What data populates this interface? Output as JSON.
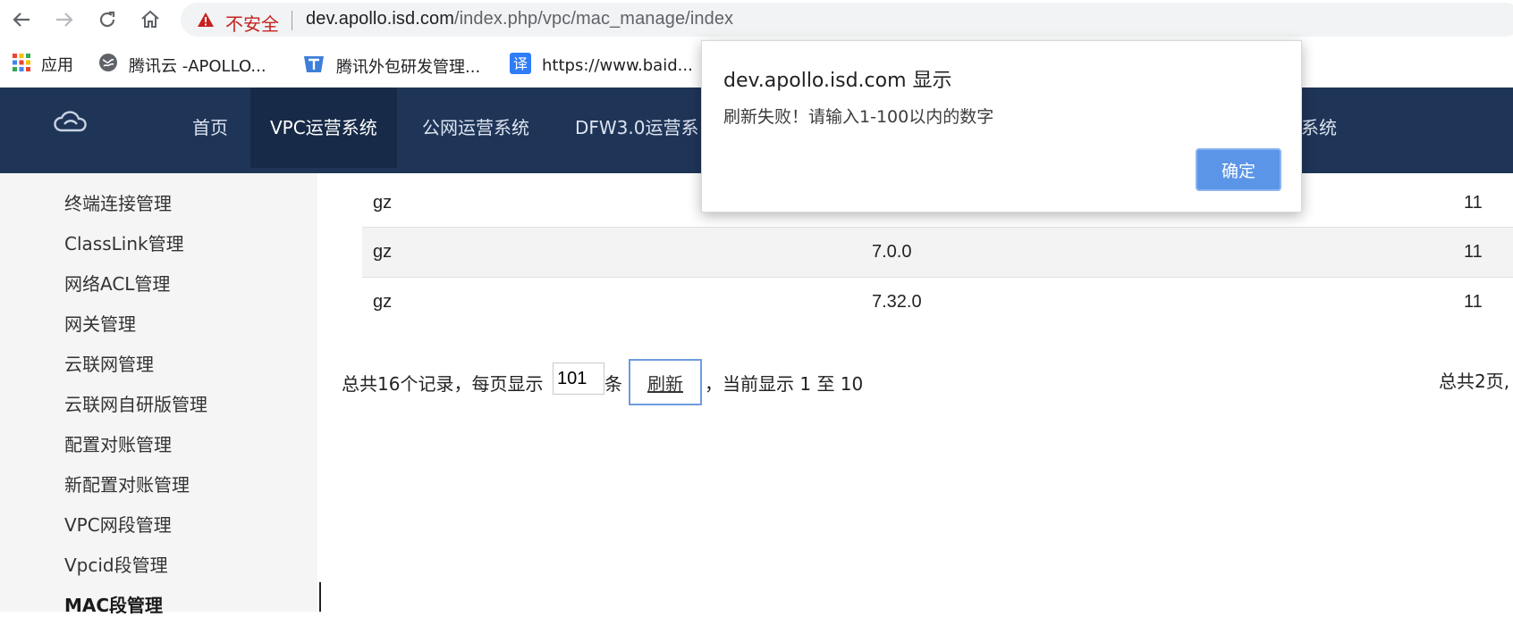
{
  "browser": {
    "security_label": "不安全",
    "url_host": "dev.apollo.isd.com",
    "url_path": "/index.php/vpc/mac_manage/index",
    "bookmarks": [
      {
        "label": "应用",
        "icon": "apps-grid-icon"
      },
      {
        "label": "腾讯云 -APOLLO...",
        "icon": "globe-icon"
      },
      {
        "label": "腾讯外包研发管理...",
        "icon": "tencent-logo-icon"
      },
      {
        "label": "https://www.baid...",
        "icon": "translate-icon"
      }
    ]
  },
  "header": {
    "nav": [
      "首页",
      "VPC运营系统",
      "公网运营系统",
      "DFW3.0运营系",
      "系统"
    ],
    "active_index": 1
  },
  "sidebar": {
    "items": [
      "终端连接管理",
      "ClassLink管理",
      "网络ACL管理",
      "网关管理",
      "云联网管理",
      "云联网自研版管理",
      "配置对账管理",
      "新配置对账管理",
      "VPC网段管理",
      "Vpcid段管理",
      "MAC段管理"
    ],
    "active_index": 10
  },
  "table": {
    "rows": [
      {
        "region": "gz",
        "version": "",
        "count": "11"
      },
      {
        "region": "gz",
        "version": "7.0.0",
        "count": "11"
      },
      {
        "region": "gz",
        "version": "7.32.0",
        "count": "11"
      }
    ]
  },
  "pager": {
    "prefix": "总共16个记录，每页显示",
    "page_size_value": "101",
    "unit": "条",
    "refresh_label": "刷新",
    "current_range": "，当前显示 1 至 10",
    "total_pages": "总共2页,"
  },
  "dialog": {
    "title": "dev.apollo.isd.com 显示",
    "message": "刷新失败！请输入1-100以内的数字",
    "ok_label": "确定"
  },
  "colors": {
    "header_bg": "#1f3558",
    "header_active_bg": "#172a47",
    "dialog_button": "#5b95e8",
    "insecure_red": "#c5221f"
  }
}
